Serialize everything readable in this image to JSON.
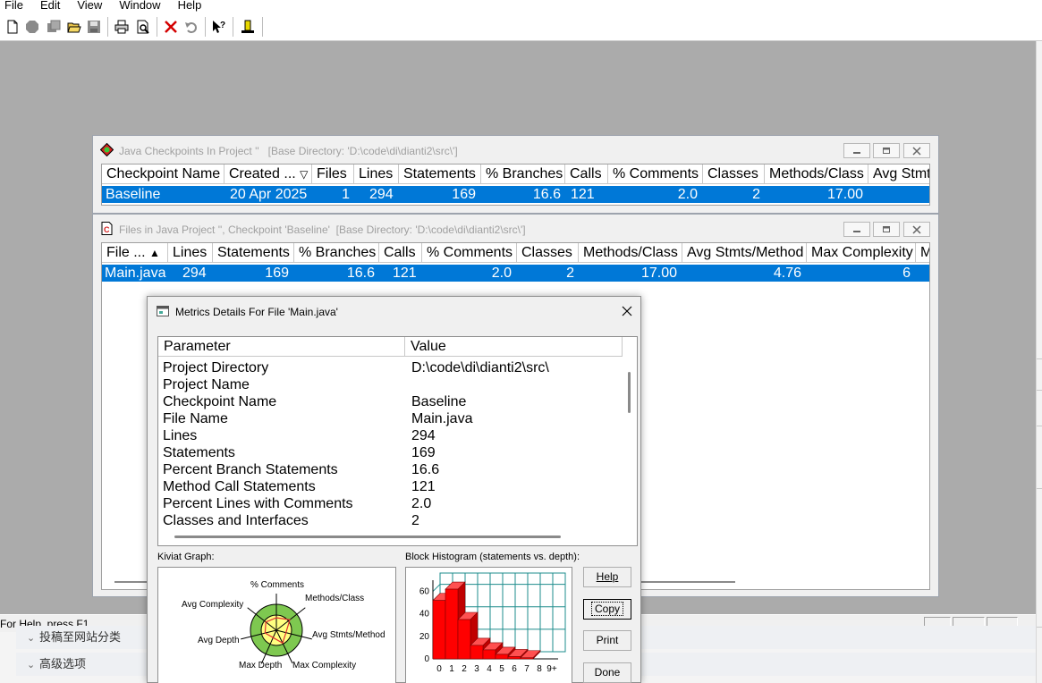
{
  "menu": [
    "File",
    "Edit",
    "View",
    "Window",
    "Help"
  ],
  "toolbar": {
    "buttons": [
      {
        "name": "new-icon",
        "color": "#000000"
      },
      {
        "name": "stop-icon",
        "color": "#8a8a8a"
      },
      {
        "name": "stack-icon",
        "color": "#8a8a8a"
      },
      {
        "name": "open-folder-icon",
        "color": "#c9a028"
      },
      {
        "name": "save-icon",
        "color": "#8a8a8a"
      },
      {
        "name": "print-icon",
        "color": "#000000"
      },
      {
        "name": "print-preview-icon",
        "color": "#000000"
      },
      {
        "name": "delete-icon",
        "color": "#d40000"
      },
      {
        "name": "undo-icon",
        "color": "#8a8a8a"
      },
      {
        "name": "context-help-icon",
        "color": "#000000"
      },
      {
        "name": "exit-icon",
        "color": "#d4c400"
      }
    ]
  },
  "status": {
    "text": "For Help, press F1"
  },
  "web_bg": {
    "row1": "投稿至网站分类",
    "row2": "高级选项"
  },
  "checkpoints_window": {
    "title": "Java Checkpoints In Project ''",
    "base_dir": "[Base Directory: 'D:\\code\\di\\dianti2\\src\\']",
    "columns": [
      "Checkpoint Name",
      "Created ...",
      "Files",
      "Lines",
      "Statements",
      "% Branches",
      "Calls",
      "% Comments",
      "Classes",
      "Methods/Class",
      "Avg Stmts"
    ],
    "sort_indicator": "▽",
    "rows": [
      [
        "Baseline",
        "20 Apr 2025",
        "1",
        "294",
        "169",
        "16.6",
        "121",
        "2.0",
        "2",
        "17.00",
        ""
      ]
    ]
  },
  "files_window": {
    "title": "Files in Java Project '', Checkpoint 'Baseline'",
    "base_dir": "[Base Directory: 'D:\\code\\di\\dianti2\\src\\']",
    "columns": [
      "File ...",
      "Lines",
      "Statements",
      "% Branches",
      "Calls",
      "% Comments",
      "Classes",
      "Methods/Class",
      "Avg Stmts/Method",
      "Max Complexity",
      "M"
    ],
    "sort_indicator": "▲",
    "rows": [
      [
        "Main.java",
        "294",
        "169",
        "16.6",
        "121",
        "2.0",
        "2",
        "17.00",
        "4.76",
        "6",
        ""
      ]
    ]
  },
  "dialog": {
    "title": "Metrics Details For File 'Main.java'",
    "col_param": "Parameter",
    "col_value": "Value",
    "params": [
      {
        "name": "Project Directory",
        "value": "D:\\code\\di\\dianti2\\src\\"
      },
      {
        "name": "Project Name",
        "value": ""
      },
      {
        "name": "Checkpoint Name",
        "value": "Baseline"
      },
      {
        "name": "File Name",
        "value": "Main.java"
      },
      {
        "name": "Lines",
        "value": "294"
      },
      {
        "name": "Statements",
        "value": "169"
      },
      {
        "name": "Percent Branch Statements",
        "value": "16.6"
      },
      {
        "name": "Method Call Statements",
        "value": "121"
      },
      {
        "name": "Percent Lines with Comments",
        "value": "2.0"
      },
      {
        "name": "Classes and Interfaces",
        "value": "2"
      }
    ],
    "kiviat_label": "Kiviat Graph:",
    "histogram_label": "Block Histogram (statements vs. depth):",
    "kiviat_axes": [
      "% Comments",
      "Methods/Class",
      "Avg Stmts/Method",
      "Max Complexity",
      "Max Depth",
      "Avg Depth",
      "Avg Complexity"
    ],
    "buttons": {
      "help": "Help",
      "copy": "Copy",
      "print": "Print",
      "done": "Done"
    },
    "colors": {
      "outer_ring": "#7ec850",
      "inner_ring": "#ffff80",
      "bars": "#ff0000",
      "grid": "#1e8c8c"
    }
  },
  "chart_data": {
    "type": "bar",
    "title": "Block Histogram (statements vs. depth):",
    "categories": [
      "0",
      "1",
      "2",
      "3",
      "4",
      "5",
      "6",
      "7",
      "8",
      "9+"
    ],
    "values": [
      52,
      62,
      35,
      12,
      8,
      4,
      2,
      1,
      0,
      0
    ],
    "ylim": [
      0,
      70
    ],
    "yticks": [
      "0",
      "20",
      "40",
      "60"
    ],
    "grid": true
  }
}
